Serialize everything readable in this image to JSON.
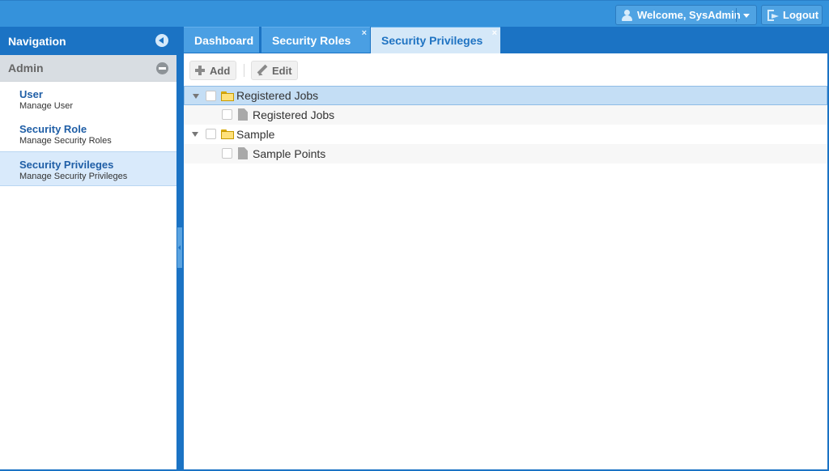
{
  "header": {
    "welcome_label": "Welcome, SysAdmin",
    "logout_label": "Logout"
  },
  "nav": {
    "title": "Navigation",
    "section": "Admin",
    "items": [
      {
        "title": "User",
        "subtitle": "Manage User",
        "selected": false
      },
      {
        "title": "Security Role",
        "subtitle": "Manage Security Roles",
        "selected": false
      },
      {
        "title": "Security Privileges",
        "subtitle": "Manage Security Privileges",
        "selected": true
      }
    ]
  },
  "tabs": [
    {
      "label": "Dashboard",
      "closable": false,
      "active": false
    },
    {
      "label": "Security Roles",
      "closable": true,
      "active": false
    },
    {
      "label": "Security Privileges",
      "closable": true,
      "active": true
    }
  ],
  "tab_close_glyph": "×",
  "toolbar": {
    "add_label": "Add",
    "edit_label": "Edit"
  },
  "tree": [
    {
      "label": "Registered Jobs",
      "type": "folder",
      "expanded": true,
      "selected": true
    },
    {
      "label": "Registered Jobs",
      "type": "leaf",
      "selected": false
    },
    {
      "label": "Sample",
      "type": "folder",
      "expanded": true,
      "selected": false
    },
    {
      "label": "Sample Points",
      "type": "leaf",
      "selected": false
    }
  ],
  "colors": {
    "header_blue": "#3592db",
    "nav_blue": "#1b73c4",
    "selected_row": "#c4def5",
    "link_blue": "#1f5ea6"
  }
}
